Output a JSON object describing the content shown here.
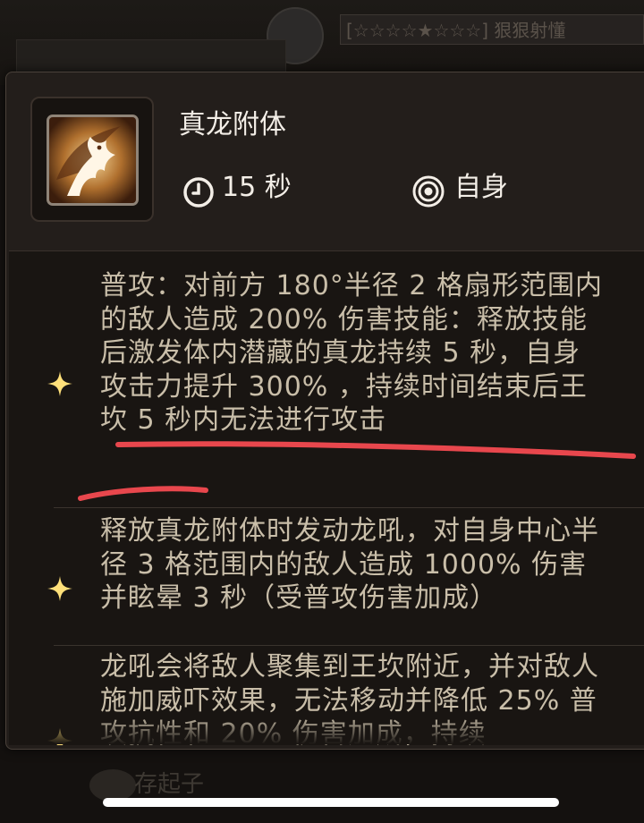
{
  "background": {
    "banner_text": "[☆☆☆☆★☆☆☆] 狠狠射懂",
    "bottom_text": "存起子"
  },
  "skill": {
    "name": "真龙附体",
    "cooldown": "15 秒",
    "target": "自身",
    "icon": "dragon-skill-icon"
  },
  "descriptions": [
    {
      "text": "普攻：对前方 180°半径 2 格扇形范围内的敌人造成 200% 伤害技能：释放技能后激发体内潜藏的真龙持续 5 秒，自身攻击力提升 300% ，持续时间结束后王坎 5 秒内无法进行攻击"
    },
    {
      "text": "释放真龙附体时发动龙吼，对自身中心半径 3 格范围内的敌人造成 1000% 伤害并眩晕 3 秒（受普攻伤害加成）"
    },
    {
      "text": "龙吼会将敌人聚集到王坎附近，并对敌人施加威吓效果，无法移动并降低 25% 普攻抗性和 20% 伤害加成，持续"
    }
  ],
  "colors": {
    "panel": "#231e1b",
    "text_primary": "#f3eee7",
    "text_desc": "#c9bea9",
    "sparkle": "#ffe07a",
    "annotation_underline": "#e8474d"
  }
}
